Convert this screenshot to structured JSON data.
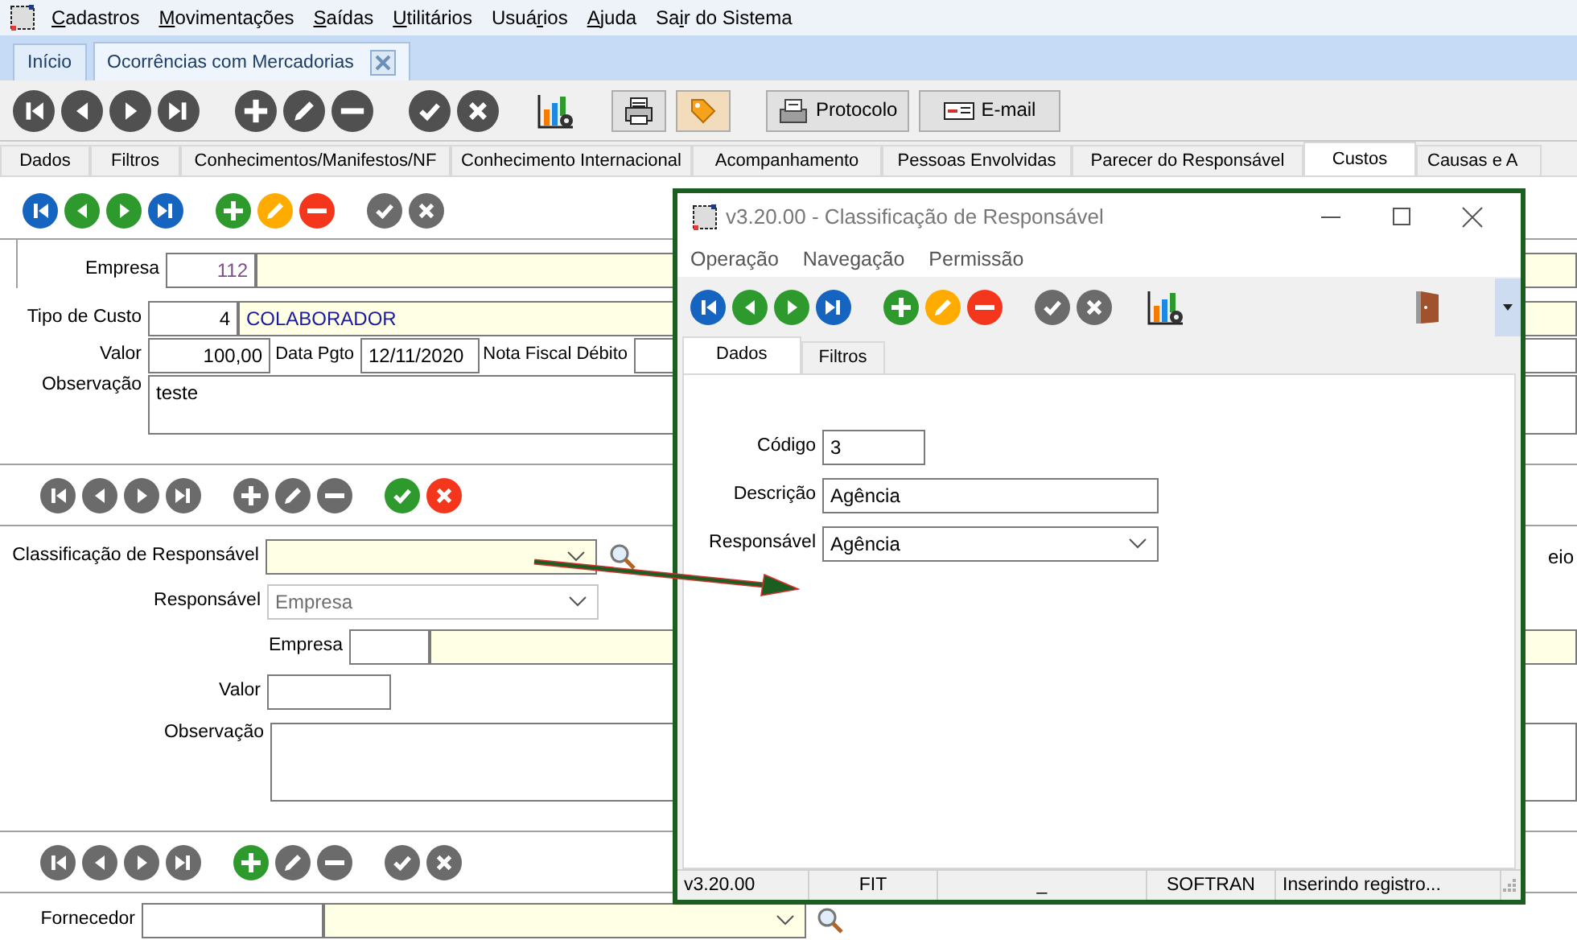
{
  "menu": [
    {
      "key": "C",
      "post": "adastros"
    },
    {
      "key": "M",
      "post": "ovimentações"
    },
    {
      "key": "S",
      "post": "aídas"
    },
    {
      "key": "U",
      "post": "tilitários"
    },
    {
      "pre": "Usuá",
      "key": "r",
      "post": "ios"
    },
    {
      "key": "A",
      "post": "juda"
    },
    {
      "pre": "Sa",
      "key": "i",
      "post": "r do Sistema"
    }
  ],
  "doc_tabs": [
    {
      "label": "Início",
      "selected": false,
      "closable": false
    },
    {
      "label": "Ocorrências com Mercadorias",
      "selected": true,
      "closable": true
    }
  ],
  "main_toolbar": [
    [
      {
        "kind": "first",
        "enabled": false
      },
      {
        "kind": "prev",
        "enabled": false
      },
      {
        "kind": "next",
        "enabled": false
      },
      {
        "kind": "last",
        "enabled": false
      }
    ],
    [
      {
        "kind": "add",
        "enabled": false
      },
      {
        "kind": "edit",
        "enabled": false
      },
      {
        "kind": "remove",
        "enabled": false
      }
    ],
    [
      {
        "kind": "confirm",
        "enabled": false
      },
      {
        "kind": "cancel",
        "enabled": false
      }
    ],
    [
      {
        "kind": "report"
      }
    ],
    [
      {
        "kind": "print"
      },
      {
        "kind": "tag"
      }
    ],
    [
      {
        "kind": "protocol",
        "label": "Protocolo"
      },
      {
        "kind": "email",
        "label": "E-mail"
      }
    ]
  ],
  "page_tabs": [
    {
      "label": "Dados",
      "selected": false
    },
    {
      "label": "Filtros",
      "selected": false
    },
    {
      "label": "Conhecimentos/Manifestos/NF",
      "selected": false
    },
    {
      "label": "Conhecimento Internacional",
      "selected": false
    },
    {
      "label": "Acompanhamento",
      "selected": false
    },
    {
      "label": "Pessoas Envolvidas",
      "selected": false
    },
    {
      "label": "Parecer do Responsável",
      "selected": false
    },
    {
      "label": "Custos",
      "selected": true
    },
    {
      "label": "Causas e A",
      "selected": false
    }
  ],
  "costs": {
    "toolbar": [
      [
        {
          "kind": "first",
          "enabled": true
        },
        {
          "kind": "prev",
          "enabled": true
        },
        {
          "kind": "next",
          "enabled": true
        },
        {
          "kind": "last",
          "enabled": true
        }
      ],
      [
        {
          "kind": "add",
          "enabled": true
        },
        {
          "kind": "edit",
          "enabled": true
        },
        {
          "kind": "remove",
          "enabled": true
        }
      ],
      [
        {
          "kind": "confirm",
          "enabled": false
        },
        {
          "kind": "cancel",
          "enabled": false
        }
      ]
    ],
    "empresa": {
      "label": "Empresa",
      "code": "112"
    },
    "tipo": {
      "label": "Tipo de Custo",
      "code": "4",
      "name": "COLABORADOR"
    },
    "valor": {
      "label": "Valor",
      "value": "100,00"
    },
    "data": {
      "label": "Data Pgto",
      "value": "12/11/2020"
    },
    "nf": {
      "label": "Nota Fiscal Débito"
    },
    "obs": {
      "label": "Observação",
      "value": "teste"
    }
  },
  "responsibles": {
    "toolbar": [
      [
        {
          "kind": "first",
          "enabled": false
        },
        {
          "kind": "prev",
          "enabled": false
        },
        {
          "kind": "next",
          "enabled": false
        },
        {
          "kind": "last",
          "enabled": false
        }
      ],
      [
        {
          "kind": "add",
          "enabled": false
        },
        {
          "kind": "edit",
          "enabled": false
        },
        {
          "kind": "remove",
          "enabled": false
        }
      ],
      [
        {
          "kind": "confirm",
          "enabled": true
        },
        {
          "kind": "cancel",
          "enabled": true
        }
      ]
    ],
    "classificacao": {
      "label": "Classificação de Responsável"
    },
    "side_text": "eio",
    "responsavel": {
      "label": "Responsável",
      "value": "Empresa",
      "disabled": true
    },
    "empresa": {
      "label": "Empresa"
    },
    "valor": {
      "label": "Valor"
    },
    "obs": {
      "label": "Observação"
    }
  },
  "suppliers": {
    "toolbar": [
      [
        {
          "kind": "first",
          "enabled": false
        },
        {
          "kind": "prev",
          "enabled": false
        },
        {
          "kind": "next",
          "enabled": false
        },
        {
          "kind": "last",
          "enabled": false
        }
      ],
      [
        {
          "kind": "add",
          "enabled": true
        },
        {
          "kind": "edit",
          "enabled": false
        },
        {
          "kind": "remove",
          "enabled": false
        }
      ],
      [
        {
          "kind": "confirm",
          "enabled": false
        },
        {
          "kind": "cancel",
          "enabled": false
        }
      ]
    ],
    "fornecedor": {
      "label": "Fornecedor"
    }
  },
  "dialog": {
    "title": "v3.20.00 - Classificação de Responsável",
    "menu": [
      "Operação",
      "Navegação",
      "Permissão"
    ],
    "toolbar": [
      [
        {
          "kind": "first",
          "enabled": true
        },
        {
          "kind": "prev",
          "enabled": true
        },
        {
          "kind": "next",
          "enabled": true
        },
        {
          "kind": "last",
          "enabled": true
        }
      ],
      [
        {
          "kind": "add",
          "enabled": true
        },
        {
          "kind": "edit",
          "enabled": true
        },
        {
          "kind": "remove",
          "enabled": true
        }
      ],
      [
        {
          "kind": "confirm",
          "enabled": false
        },
        {
          "kind": "cancel",
          "enabled": false
        }
      ],
      [
        {
          "kind": "report"
        }
      ]
    ],
    "tabs": [
      {
        "label": "Dados",
        "selected": true
      },
      {
        "label": "Filtros",
        "selected": false
      }
    ],
    "codigo": {
      "label": "Código",
      "value": "3"
    },
    "descricao": {
      "label": "Descrição",
      "value": "Agência"
    },
    "responsavel": {
      "label": "Responsável",
      "value": "Agência"
    },
    "status": [
      "v3.20.00",
      "FIT",
      "_",
      "SOFTRAN",
      "Inserindo registro..."
    ]
  }
}
